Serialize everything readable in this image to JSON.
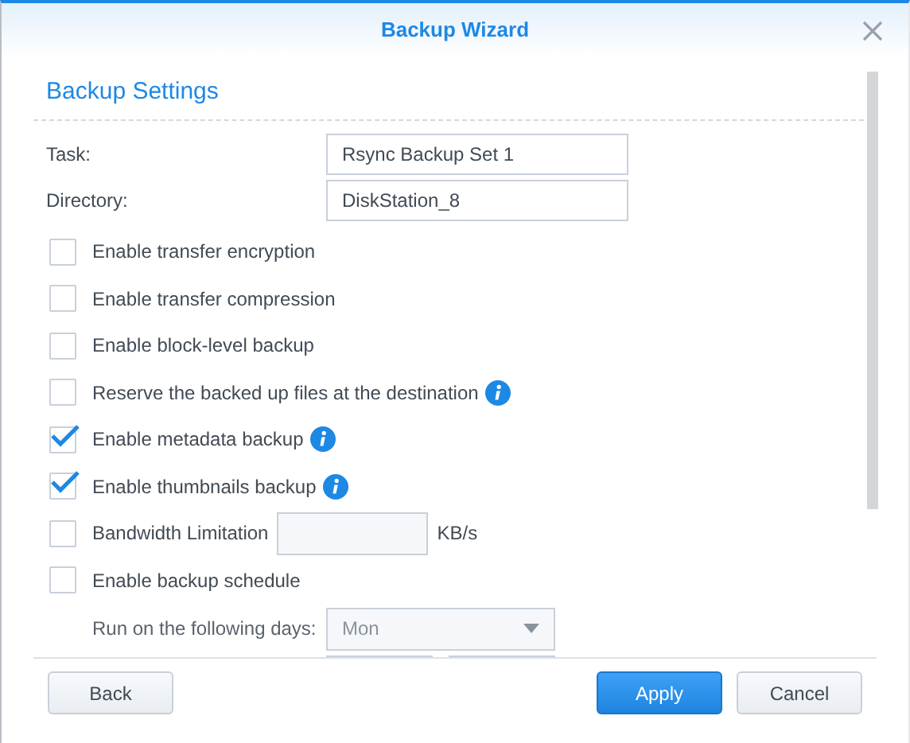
{
  "window": {
    "title": "Backup Wizard"
  },
  "section_title": "Backup Settings",
  "fields": [
    {
      "label": "Task:",
      "value": "Rsync Backup Set 1"
    },
    {
      "label": "Directory:",
      "value": "DiskStation_8"
    }
  ],
  "options": [
    {
      "kind": "checkbox",
      "label": "Enable transfer encryption",
      "checked": false,
      "info": false
    },
    {
      "kind": "checkbox",
      "label": "Enable transfer compression",
      "checked": false,
      "info": false
    },
    {
      "kind": "checkbox",
      "label": "Enable block-level backup",
      "checked": false,
      "info": false
    },
    {
      "kind": "checkbox",
      "label": "Reserve the backed up files at the destination",
      "checked": false,
      "info": true
    },
    {
      "kind": "checkbox",
      "label": "Enable metadata backup",
      "checked": true,
      "info": true
    },
    {
      "kind": "checkbox",
      "label": "Enable thumbnails backup",
      "checked": true,
      "info": true
    },
    {
      "kind": "bandwidth",
      "label": "Bandwidth Limitation",
      "checked": false,
      "info": false,
      "unit": "KB/s"
    },
    {
      "kind": "checkbox",
      "label": "Enable backup schedule",
      "checked": false,
      "info": false
    }
  ],
  "schedule": {
    "label": "Run on the following days:",
    "value": "Mon"
  },
  "buttons": [
    {
      "label": "Back",
      "primary": false
    },
    {
      "label": "Apply",
      "primary": true
    },
    {
      "label": "Cancel",
      "primary": false
    }
  ]
}
